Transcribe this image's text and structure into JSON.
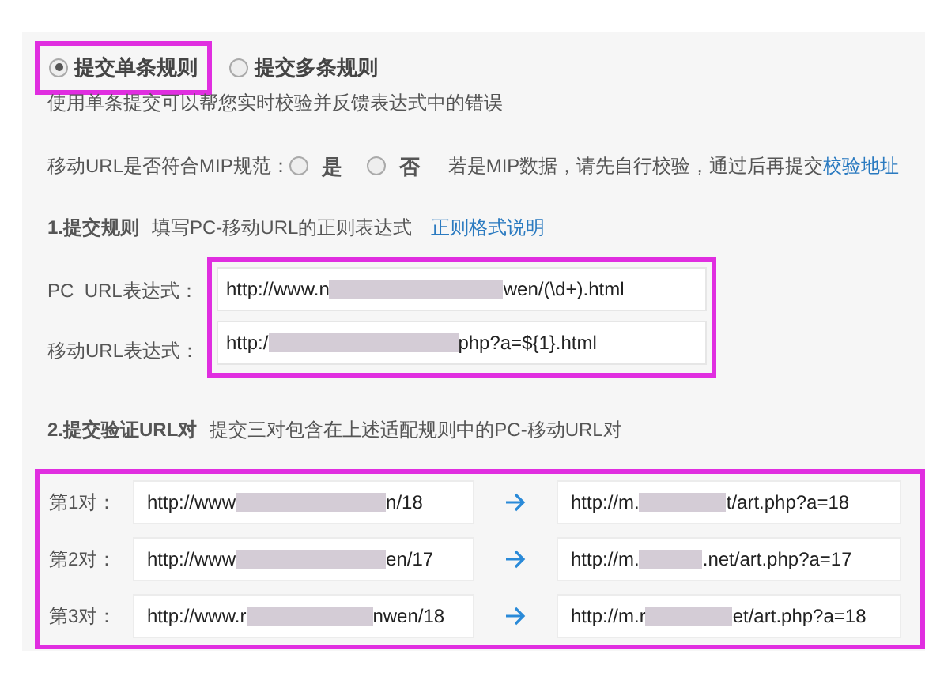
{
  "modes": [
    {
      "label": "提交单条规则",
      "selected": true,
      "highlighted": true
    },
    {
      "label": "提交多条规则",
      "selected": false,
      "highlighted": false
    }
  ],
  "mode_hint": "使用单条提交可以帮您实时校验并反馈表达式中的错误",
  "mip": {
    "label": "移动URL是否符合MIP规范：",
    "options": [
      {
        "label": "是",
        "selected": false
      },
      {
        "label": "否",
        "selected": false
      }
    ],
    "note": "若是MIP数据，请先自行校验，通过后再提交",
    "link": "校验地址"
  },
  "rules": {
    "heading": "1.提交规则",
    "hint": "填写PC-移动URL的正则表达式",
    "link": "正则格式说明",
    "highlighted": true,
    "fields": [
      {
        "label": "PC  URL表达式：",
        "value_start": "http://www.n",
        "value_end": "wen/(\\d+).html"
      },
      {
        "label": "移动URL表达式：",
        "value_start": "http:/",
        "value_end": "php?a=${1}.html"
      }
    ]
  },
  "pairs": {
    "heading": "2.提交验证URL对",
    "hint": "提交三对包含在上述适配规则中的PC-移动URL对",
    "highlighted": true,
    "rows": [
      {
        "label": "第1对：",
        "pc_start": "http://www",
        "pc_end": "n/18",
        "mobile_start": "http://m.",
        "mobile_end": "t/art.php?a=18"
      },
      {
        "label": "第2对：",
        "pc_start": "http://www",
        "pc_end": "en/17",
        "mobile_start": "http://m.",
        "mobile_end": ".net/art.php?a=17"
      },
      {
        "label": "第3对：",
        "pc_start": "http://www.r",
        "pc_end": "nwen/18",
        "mobile_start": "http://m.r",
        "mobile_end": "et/art.php?a=18"
      }
    ]
  }
}
